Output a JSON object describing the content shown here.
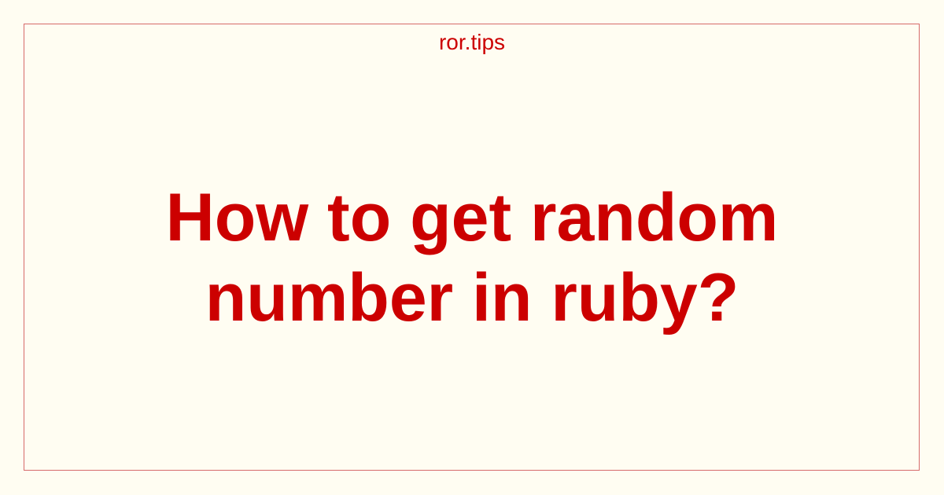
{
  "card": {
    "site_name": "ror.tips",
    "title_lines": [
      "How to get random",
      "number in ruby?"
    ]
  },
  "colors": {
    "background": "#fffdf2",
    "accent": "#cc0000",
    "border": "#d66a6a"
  }
}
